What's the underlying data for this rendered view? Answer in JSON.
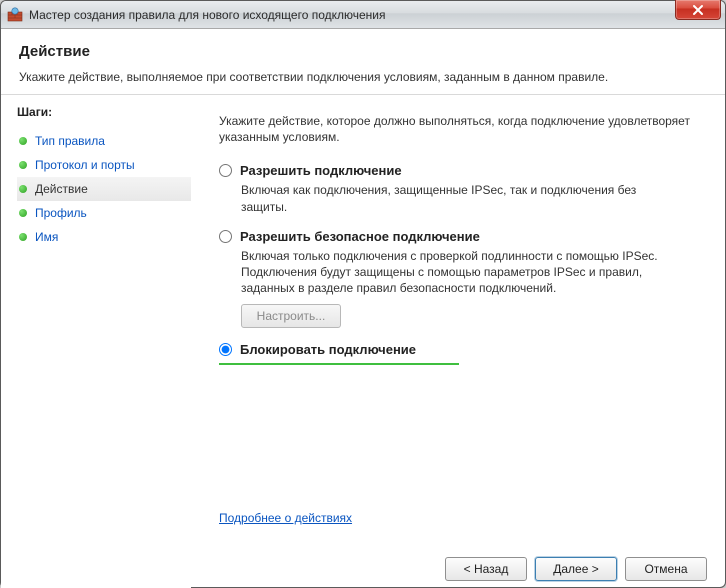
{
  "window": {
    "title": "Мастер создания правила для нового исходящего подключения"
  },
  "header": {
    "title": "Действие",
    "subtitle": "Укажите действие, выполняемое при соответствии подключения условиям, заданным в данном правиле."
  },
  "sidebar": {
    "title": "Шаги:",
    "items": [
      {
        "label": "Тип правила",
        "current": false
      },
      {
        "label": "Протокол и порты",
        "current": false
      },
      {
        "label": "Действие",
        "current": true
      },
      {
        "label": "Профиль",
        "current": false
      },
      {
        "label": "Имя",
        "current": false
      }
    ]
  },
  "content": {
    "instruction": "Укажите действие, которое должно выполняться, когда подключение удовлетворяет указанным условиям.",
    "options": [
      {
        "title": "Разрешить подключение",
        "desc": "Включая как подключения, защищенные IPSec, так и подключения без защиты.",
        "selected": false,
        "has_configure": false
      },
      {
        "title": "Разрешить безопасное подключение",
        "desc": "Включая только подключения с проверкой подлинности с помощью IPSec. Подключения будут защищены с помощью параметров IPSec и правил, заданных в разделе правил безопасности подключений.",
        "selected": false,
        "has_configure": true
      },
      {
        "title": "Блокировать подключение",
        "desc": "",
        "selected": true,
        "has_configure": false
      }
    ],
    "configure_label": "Настроить...",
    "learn_more": "Подробнее о действиях"
  },
  "footer": {
    "back": "< Назад",
    "next": "Далее >",
    "cancel": "Отмена"
  }
}
